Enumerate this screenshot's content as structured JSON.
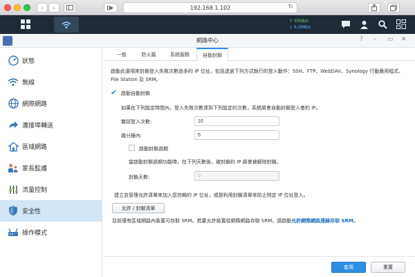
{
  "browser": {
    "url": "192.168.1.102",
    "back_icon": "chevron-left-icon",
    "forward_icon": "chevron-right-icon"
  },
  "taskbar": {
    "upload_speed": "35KB/s",
    "download_speed": "6.3MB/s"
  },
  "window": {
    "title": "網路中心",
    "controls": [
      "?",
      "–",
      "▭",
      "✕"
    ]
  },
  "sidebar": {
    "items": [
      {
        "label": "狀態",
        "icon": "gauge-icon"
      },
      {
        "label": "無線",
        "icon": "wifi-icon"
      },
      {
        "label": "網際網路",
        "icon": "globe-icon"
      },
      {
        "label": "連接埠轉送",
        "icon": "arrow-forward-icon"
      },
      {
        "label": "區域網路",
        "icon": "lan-icon"
      },
      {
        "label": "家長監護",
        "icon": "family-icon"
      },
      {
        "label": "流量控制",
        "icon": "sliders-icon"
      },
      {
        "label": "安全性",
        "icon": "shield-icon"
      },
      {
        "label": "操作模式",
        "icon": "router-icon"
      }
    ],
    "active_index": 7
  },
  "tabs": [
    "一般",
    "防火牆",
    "系統服務",
    "自動封鎖"
  ],
  "active_tab": 3,
  "main": {
    "description": "啟動此選項來封鎖登入失敗次數過多的 IP 位址，包括透過下列方式執行的登入動作：SSH、FTP、WebDAV、Synology 行動應用程式、File Station 及 SRM。",
    "enable_autoblock_label": "啟動自動封鎖",
    "autoblock_hint": "如果在下列設定時間內，登入失敗次數達到下列設定的次數，系統將會自動封鎖登入者的 IP。",
    "login_attempts_label": "嘗試登入次數:",
    "login_attempts_value": "10",
    "within_minutes_label": "幾分鐘內:",
    "within_minutes_value": "5",
    "enable_expiry_label": "啟動封鎖過期",
    "expiry_hint": "當啟動封鎖過期功能時，在下列天數後，被封鎖的 IP 將會被解除封鎖。",
    "block_days_label": "封鎖天數:",
    "block_days_value": "0",
    "list_hint": "建立並管理允許清單來加入您信賴的 IP 位址，或是利用封鎖清單來防止特定 IP 位址登入。",
    "allow_block_button": "允許 / 封鎖清單",
    "srm_note_prefix": "目前僅有區域網路內裝置可存取 SRM。若要允許裝置從網際網路存取 SRM，請啟動",
    "srm_note_link": "允許網際網路連線存取 SRM",
    "srm_note_suffix": "。"
  },
  "footer": {
    "apply_label": "套用",
    "reset_label": "重置"
  },
  "colors": {
    "accent": "#2f8de4",
    "taskbar": "#1e2a36",
    "active_sidebar": "#d3e6f6"
  }
}
